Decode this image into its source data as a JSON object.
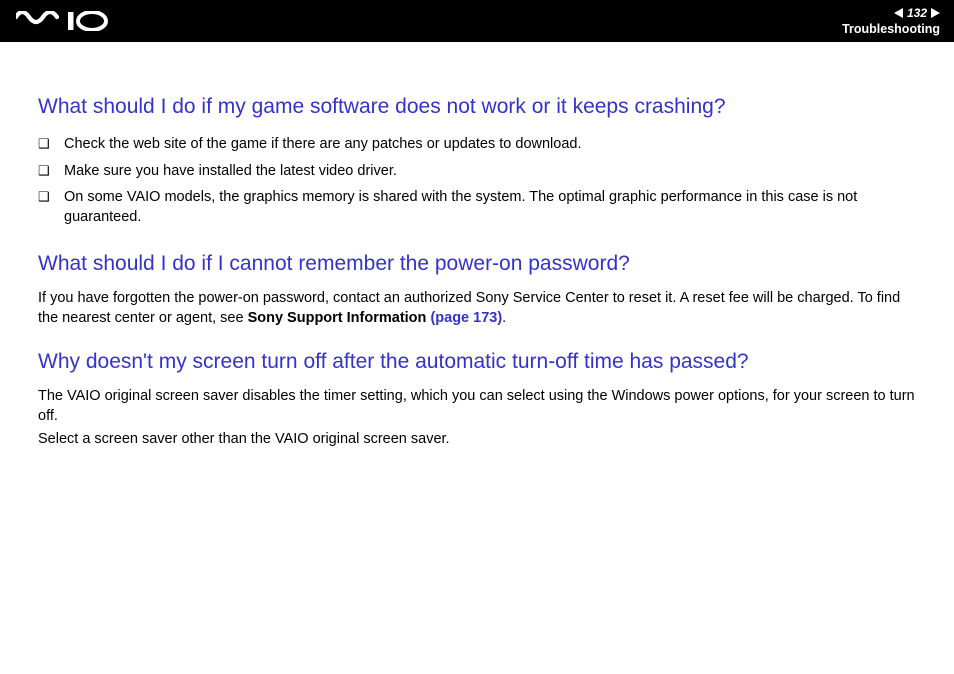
{
  "header": {
    "page_number": "132",
    "section": "Troubleshooting"
  },
  "sections": [
    {
      "heading": "What should I do if my game software does not work or it keeps crashing?",
      "bullets": [
        "Check the web site of the game if there are any patches or updates to download.",
        "Make sure you have installed the latest video driver.",
        "On some VAIO models, the graphics memory is shared with the system. The optimal graphic performance in this case is not guaranteed."
      ]
    },
    {
      "heading": "What should I do if I cannot remember the power-on password?",
      "para_pre": "If you have forgotten the power-on password, contact an authorized Sony Service Center to reset it. A reset fee will be charged. To find the nearest center or agent, see ",
      "link_bold": "Sony Support Information ",
      "link_page": "(page 173)",
      "para_post": "."
    },
    {
      "heading": "Why doesn't my screen turn off after the automatic turn-off time has passed?",
      "para1": "The VAIO original screen saver disables the timer setting, which you can select using the Windows power options, for your screen to turn off.",
      "para2": "Select a screen saver other than the VAIO original screen saver."
    }
  ]
}
